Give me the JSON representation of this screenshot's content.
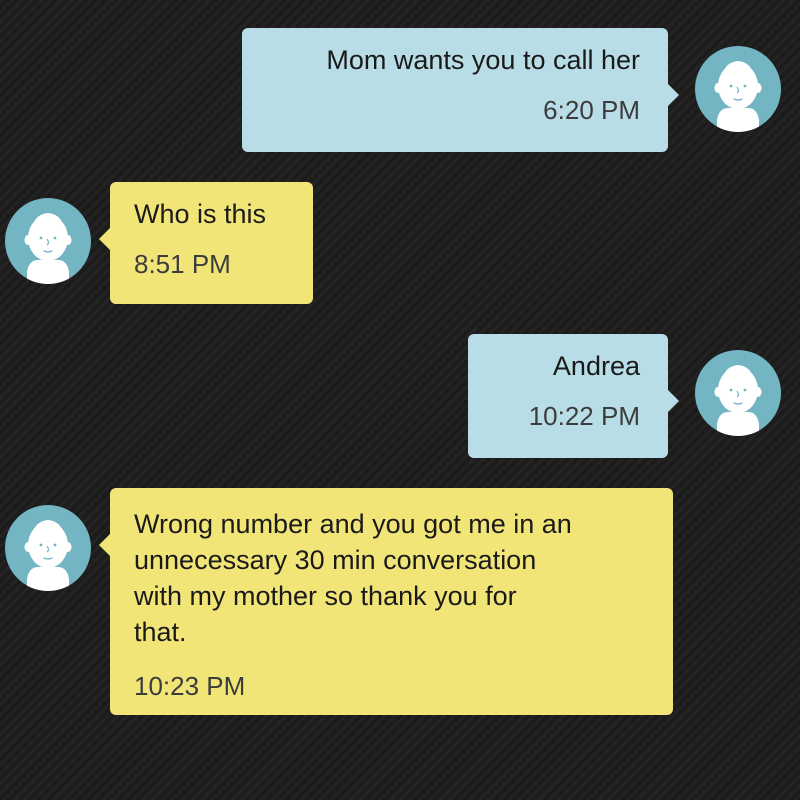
{
  "messages": [
    {
      "direction": "outgoing",
      "text": "Mom wants you to call her",
      "time": "6:20 PM"
    },
    {
      "direction": "incoming",
      "text": "Who is this",
      "time": "8:51 PM"
    },
    {
      "direction": "outgoing",
      "text": "Andrea",
      "time": "10:22 PM"
    },
    {
      "direction": "incoming",
      "text": "Wrong number and you got me in an\nunnecessary 30 min conversation\nwith my mother so thank you for\nthat.",
      "time": "10:23 PM"
    }
  ],
  "colors": {
    "background": "#1f1f1f",
    "outgoing_bubble": "#b8dde6",
    "incoming_bubble": "#f2e578",
    "avatar": "#73b5c3"
  },
  "icons": {
    "avatar": "default-contact-face-icon"
  }
}
